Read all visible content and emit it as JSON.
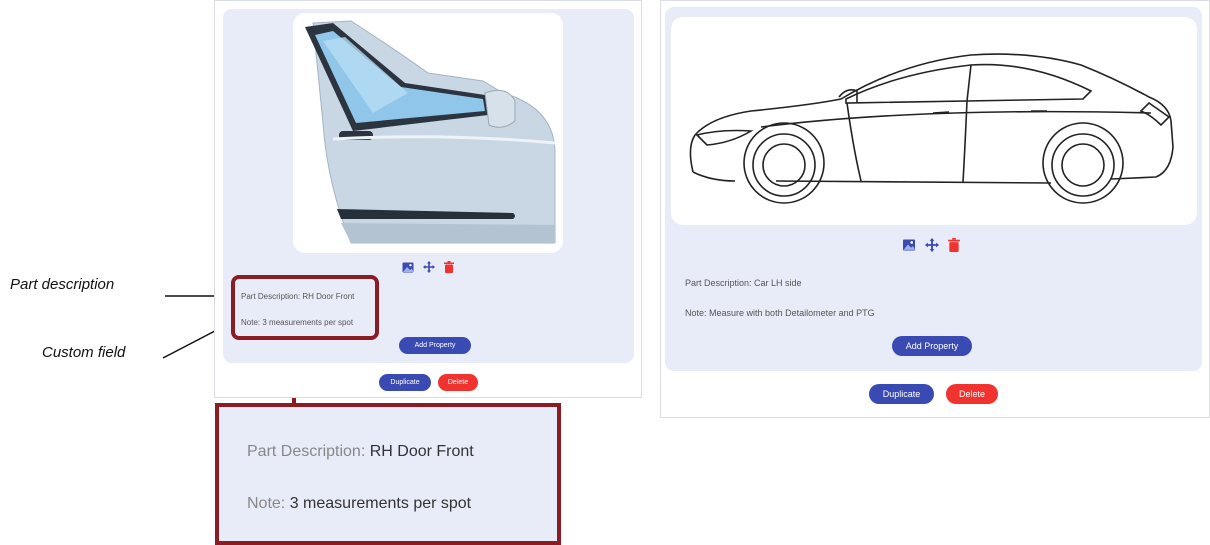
{
  "callouts": {
    "part_description": "Part description",
    "custom_field": "Custom field"
  },
  "colors": {
    "accent_blue": "#3a4ab3",
    "danger_red": "#f0332e",
    "highlight_border": "#8c1c24",
    "panel_bg": "#e8ebf8"
  },
  "left_card": {
    "image": "car-door-image",
    "icons": [
      "image-icon",
      "move-icon",
      "trash-icon"
    ],
    "part_description_label": "Part Description:",
    "part_description_value": "RH Door Front",
    "note_label": "Note:",
    "note_value": "3 measurements per spot",
    "add_property": "Add Property",
    "duplicate": "Duplicate",
    "delete": "Delete"
  },
  "right_card": {
    "image": "car-side-image",
    "icons": [
      "image-icon",
      "move-icon",
      "trash-icon"
    ],
    "part_description_label": "Part Description:",
    "part_description_value": "Car LH side",
    "note_label": "Note:",
    "note_value": "Measure with both Detailometer and PTG",
    "add_property": "Add Property",
    "duplicate": "Duplicate",
    "delete": "Delete"
  },
  "zoom": {
    "part_description_label": "Part Description:",
    "part_description_value": "RH Door Front",
    "note_label": "Note:",
    "note_value": "3 measurements per spot"
  }
}
